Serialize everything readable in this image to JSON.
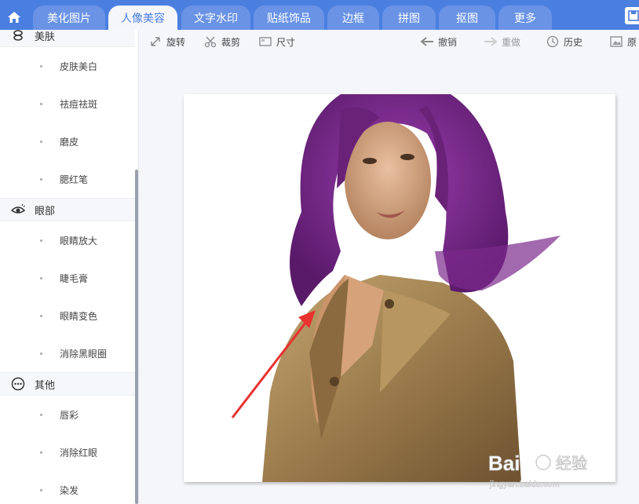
{
  "tabs": [
    {
      "label": "美化图片",
      "active": false
    },
    {
      "label": "人像美容",
      "active": true
    },
    {
      "label": "文字水印",
      "active": false
    },
    {
      "label": "贴纸饰品",
      "active": false
    },
    {
      "label": "边框",
      "active": false
    },
    {
      "label": "拼图",
      "active": false
    },
    {
      "label": "抠图",
      "active": false
    },
    {
      "label": "更多",
      "active": false
    }
  ],
  "sidebar": {
    "sections": [
      {
        "label": "美肤",
        "icon": "skin-icon",
        "items": [
          "皮肤美白",
          "祛痘祛斑",
          "磨皮",
          "腮红笔"
        ]
      },
      {
        "label": "眼部",
        "icon": "eye-icon",
        "items": [
          "眼睛放大",
          "睫毛膏",
          "眼睛变色",
          "消除黑眼圈"
        ]
      },
      {
        "label": "其他",
        "icon": "more-icon",
        "items": [
          "唇彩",
          "消除红眼",
          "染发"
        ]
      }
    ]
  },
  "toolbar": {
    "rotate": "旋转",
    "crop": "裁剪",
    "size": "尺寸",
    "undo": "撤销",
    "redo": "重做",
    "history": "历史",
    "original": "原"
  },
  "watermark": {
    "brand": "Bai",
    "brand2": "经验",
    "url": "jingyan.baidu.com"
  },
  "colors": {
    "accent": "#4a7fe0",
    "hair": "#7b2a8c",
    "coat": "#a88a5a",
    "arrow": "#e8322f"
  }
}
